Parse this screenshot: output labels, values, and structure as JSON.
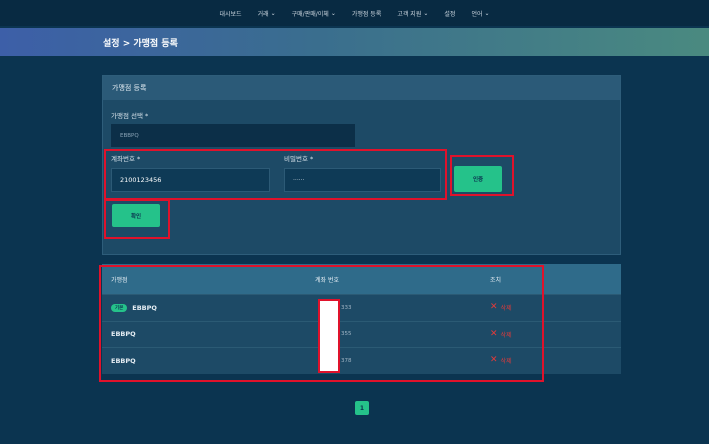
{
  "nav": {
    "items": [
      {
        "label": "대시보드",
        "chevron": false
      },
      {
        "label": "거래",
        "chevron": true
      },
      {
        "label": "구매/판매/이체",
        "chevron": true
      },
      {
        "label": "가맹점 등록",
        "chevron": false
      },
      {
        "label": "고객 지원",
        "chevron": true
      },
      {
        "label": "설정",
        "chevron": false
      },
      {
        "label": "언어",
        "chevron": true
      }
    ]
  },
  "banner": {
    "title": "설정 > 가맹점 등록"
  },
  "form": {
    "title": "가맹점 등록",
    "merchant_label": "가맹점 선택 *",
    "merchant_value": "EBBPQ",
    "account_label": "계좌번호 *",
    "account_value": "2100123456",
    "password_label": "비밀번호 *",
    "password_value": "······",
    "auth_button": "인증",
    "confirm_button": "확인"
  },
  "table": {
    "headers": [
      "가맹점",
      "계좌 번호",
      "조치"
    ],
    "rows": [
      {
        "tag": "기본",
        "merchant": "EBBPQ",
        "account": "333",
        "action": "삭제"
      },
      {
        "tag": "",
        "merchant": "EBBPQ",
        "account": "355",
        "action": "삭제"
      },
      {
        "tag": "",
        "merchant": "EBBPQ",
        "account": "378",
        "action": "삭제"
      }
    ]
  },
  "pagination": {
    "current": "1"
  },
  "colors": {
    "accent": "#25c28a",
    "danger": "#e23a3a",
    "highlight": "#e0122b",
    "background": "#0b3450"
  }
}
